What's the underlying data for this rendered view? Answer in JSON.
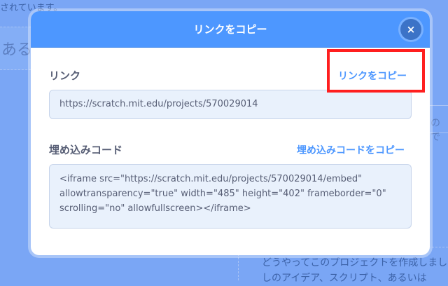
{
  "background": {
    "top_text": "されています。",
    "left_box_text": "ある",
    "right_box_text": "ので",
    "bottom_lines": [
      "どうやってこのプロジェクトを作成しまし",
      "しのアイデア、スクリプト、あるいは"
    ]
  },
  "modal": {
    "title": "リンクをコピー",
    "close_icon": "×",
    "link_section": {
      "label": "リンク",
      "copy_label": "リンクをコピー",
      "value": "https://scratch.mit.edu/projects/570029014"
    },
    "embed_section": {
      "label": "埋め込みコード",
      "copy_label": "埋め込みコードをコピー",
      "lines": [
        "<iframe src=\"https://scratch.mit.edu/projects/570029014/embed\"",
        "allowtransparency=\"true\" width=\"485\" height=\"402\" frameborder=\"0\"",
        "scrolling=\"no\" allowfullscreen></iframe>"
      ]
    }
  },
  "colors": {
    "header": "#4d97ff",
    "accent": "#4d97ff",
    "highlight": "#ff1f1f",
    "overlay": "#7aa6f5"
  }
}
